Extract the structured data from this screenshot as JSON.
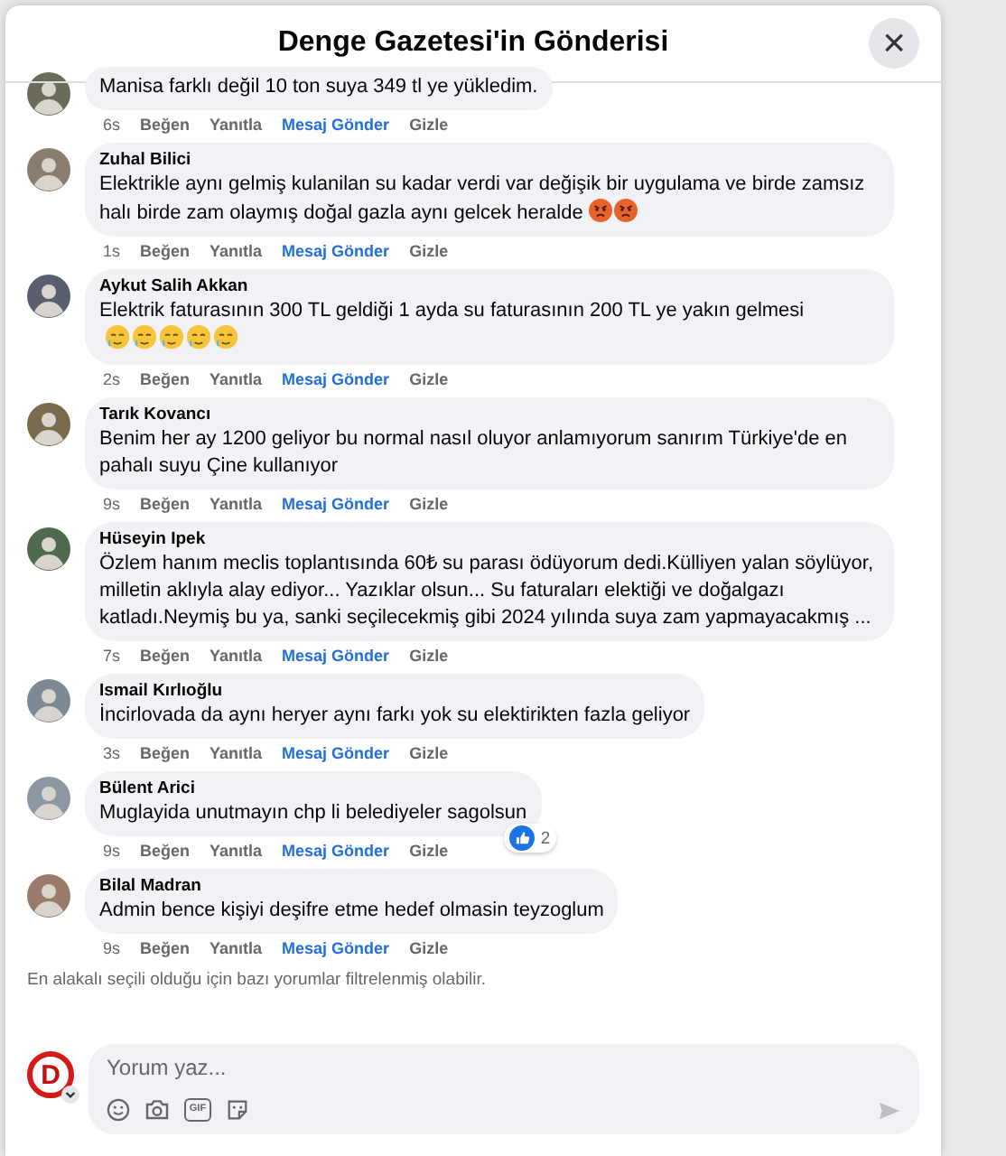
{
  "dialog": {
    "title": "Denge Gazetesi'in Gönderisi",
    "close": "×"
  },
  "comments": [
    {
      "text": "Manisa farklı değil 10 ton suya 349 tl ye yükledim.",
      "time": "6s",
      "actions": [
        "Beğen",
        "Yanıtla",
        "Mesaj Gönder",
        "Gizle"
      ]
    },
    {
      "name": "Zuhal Bilici",
      "text": "Elektrikle aynı gelmiş kulanilan su kadar verdi var değişik bir uygulama ve birde zamsız halı birde zam olaymış doğal gazla aynı gelcek heralde",
      "emojis": [
        {
          "kind": "angry"
        },
        {
          "kind": "angry"
        }
      ],
      "time": "1s",
      "actions": [
        "Beğen",
        "Yanıtla",
        "Mesaj Gönder",
        "Gizle"
      ]
    },
    {
      "name": "Aykut Salih Akkan",
      "text": "Elektrik faturasının 300 TL geldiği 1 ayda su faturasının 200 TL ye yakın gelmesi",
      "emojis": [
        {
          "kind": "tear"
        },
        {
          "kind": "tear"
        },
        {
          "kind": "tear"
        },
        {
          "kind": "tear"
        },
        {
          "kind": "tear"
        }
      ],
      "time": "2s",
      "actions": [
        "Beğen",
        "Yanıtla",
        "Mesaj Gönder",
        "Gizle"
      ]
    },
    {
      "name": "Tarık Kovancı",
      "text": "Benim her ay 1200 geliyor bu normal nasıl oluyor anlamıyorum sanırım Türkiye'de en pahalı suyu Çine kullanıyor",
      "time": "9s",
      "actions": [
        "Beğen",
        "Yanıtla",
        "Mesaj Gönder",
        "Gizle"
      ]
    },
    {
      "name": "Hüseyin Ipek",
      "text": "Özlem hanım meclis toplantısında 60₺ su parası ödüyorum dedi.Külliyen yalan söylüyor, milletin aklıyla alay ediyor... Yazıklar olsun... Su faturaları elektiği ve doğalgazı katladı.Neymiş bu ya, sanki seçilecekmiş gibi 2024 yılında suya zam yapmayacakmış ...",
      "time": "7s",
      "actions": [
        "Beğen",
        "Yanıtla",
        "Mesaj Gönder",
        "Gizle"
      ]
    },
    {
      "name": "Ismail Kırlıoğlu",
      "text": "İncirlovada da aynı heryer aynı farkı yok su elektirikten fazla geliyor",
      "time": "3s",
      "actions": [
        "Beğen",
        "Yanıtla",
        "Mesaj Gönder",
        "Gizle"
      ]
    },
    {
      "name": "Bülent Arici",
      "text": "Muglayida unutmayın chp li belediyeler sagolsun",
      "likes": "2",
      "time": "9s",
      "actions": [
        "Beğen",
        "Yanıtla",
        "Mesaj Gönder",
        "Gizle"
      ]
    },
    {
      "name": "Bilal Madran",
      "text": "Admin bence kişiyi deşifre etme hedef olmasin teyzoglum",
      "time": "9s",
      "actions": [
        "Beğen",
        "Yanıtla",
        "Mesaj Gönder",
        "Gizle"
      ]
    }
  ],
  "filter_note": "En alakalı seçili olduğu için bazı yorumlar filtrelenmiş olabilir.",
  "composer": {
    "avatar_letter": "D",
    "placeholder": "Yorum yaz...",
    "gif_label": "GIF"
  }
}
